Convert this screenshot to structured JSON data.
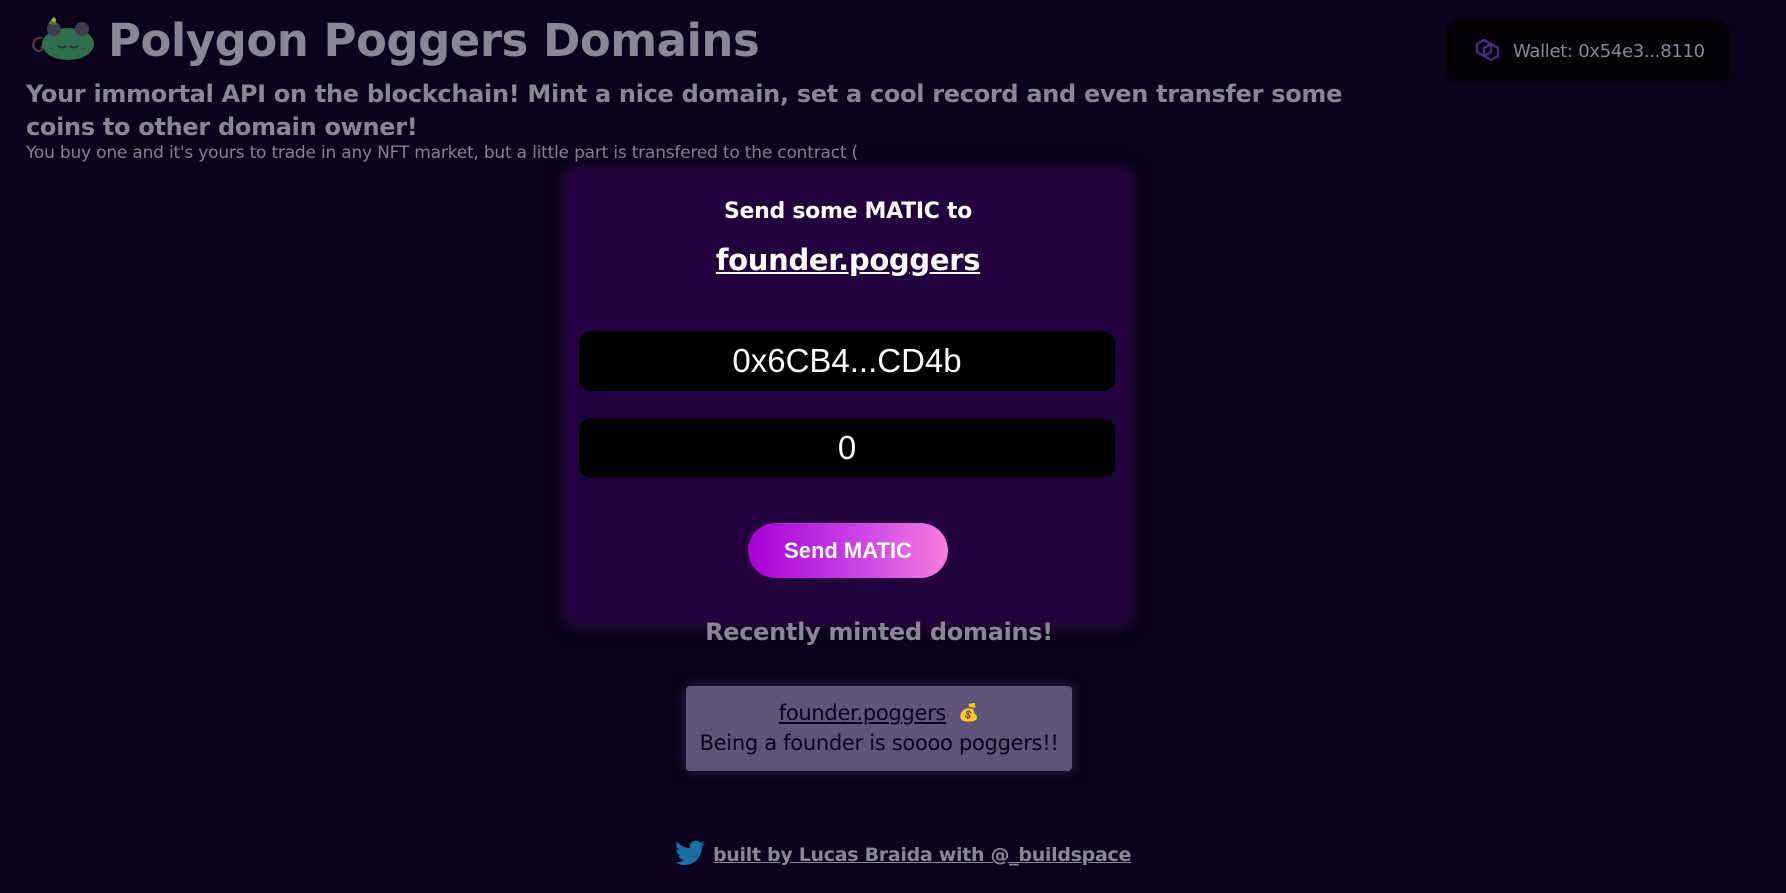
{
  "header": {
    "title": "Polygon Poggers Domains",
    "subtitle": "Your immortal API on the blockchain! Mint a nice domain, set a cool record and even transfer some coins to other domain owner!",
    "description": "You buy one and it's yours to trade in any NFT market, but a little part is transfered to the contract ("
  },
  "wallet": {
    "label": "Wallet: 0x54e3...8110",
    "icon": "polygon-icon"
  },
  "send_card": {
    "heading": "Send some MATIC to",
    "domain": "founder.poggers",
    "address_value": "0x6CB4...CD4b",
    "amount_value": "0",
    "button_label": "Send MATIC"
  },
  "recent": {
    "title": "Recently minted domains!",
    "items": [
      {
        "name": "founder.poggers",
        "icon": "moneybag-icon",
        "emoji": "💰",
        "record": "Being a founder is soooo poggers!!"
      }
    ]
  },
  "footer": {
    "text": "built by Lucas Braida with @_buildspace",
    "icon": "twitter-icon"
  },
  "colors": {
    "background": "#0b021b",
    "card": "#23003e",
    "button_gradient_start": "#a700d6",
    "button_gradient_end": "#f77ee0",
    "text_muted": "#8a8794",
    "mint_card": "#5e5478",
    "polygon_purple": "#4a2d8a",
    "twitter_blue": "#1d6ea8"
  }
}
